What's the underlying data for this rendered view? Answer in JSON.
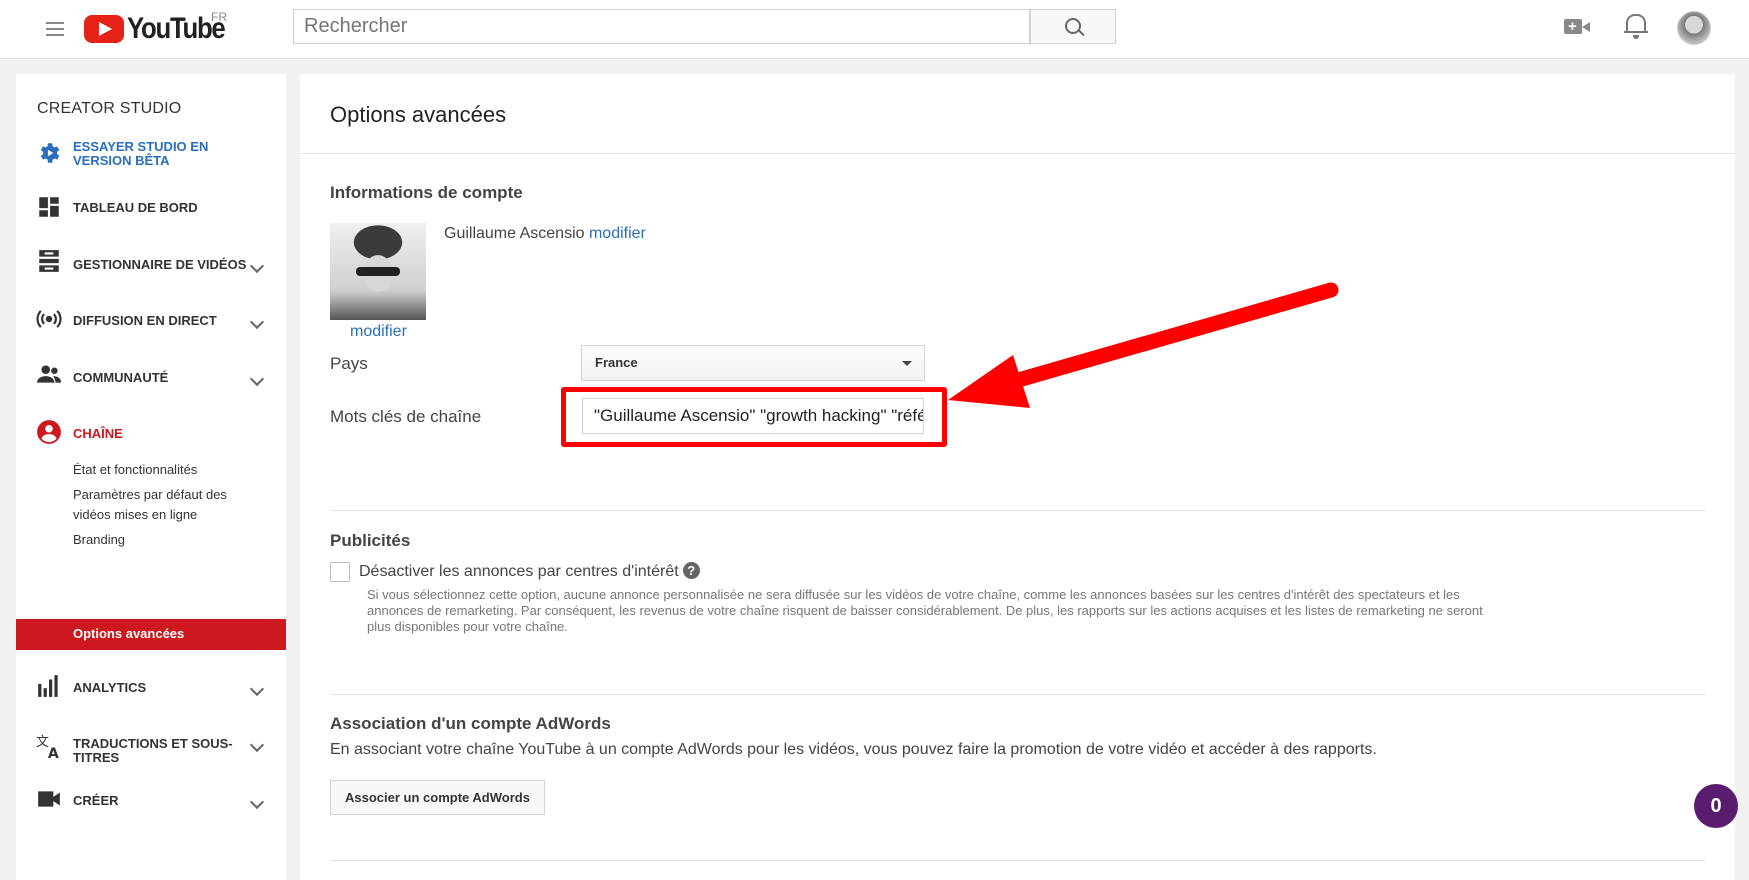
{
  "header": {
    "logo_text": "YouTube",
    "locale_badge": "FR",
    "search_placeholder": "Rechercher",
    "icons": [
      "menu-icon",
      "search-icon",
      "add-video-icon",
      "bell-icon",
      "avatar"
    ]
  },
  "sidebar": {
    "title": "CREATOR STUDIO",
    "items": [
      {
        "icon": "gear-icon",
        "label": "ESSAYER STUDIO EN VERSION BÊTA",
        "color": "#2a6ebd"
      },
      {
        "icon": "dashboard-icon",
        "label": "TABLEAU DE BORD"
      },
      {
        "icon": "video-manager-icon",
        "label": "GESTIONNAIRE DE VIDÉOS",
        "expandable": true
      },
      {
        "icon": "live-icon",
        "label": "DIFFUSION EN DIRECT",
        "expandable": true
      },
      {
        "icon": "community-icon",
        "label": "COMMUNAUTÉ",
        "expandable": true
      },
      {
        "icon": "channel-icon",
        "label": "CHAÎNE",
        "color": "#cc181e"
      },
      {
        "icon": "analytics-icon",
        "label": "ANALYTICS",
        "expandable": true
      },
      {
        "icon": "translate-icon",
        "label": "TRADUCTIONS ET SOUS-TITRES",
        "expandable": true
      },
      {
        "icon": "create-icon",
        "label": "CRÉER",
        "expandable": true
      }
    ],
    "channel_sub": [
      "État et fonctionnalités",
      "Paramètres par défaut des vidéos mises en ligne",
      "Branding",
      "Options avancées"
    ],
    "active_sub": "Options avancées",
    "active_color": "#cc181e"
  },
  "main": {
    "title": "Options avancées",
    "account": {
      "heading": "Informations de compte",
      "name": "Guillaume Ascensio",
      "modify_link": "modifier",
      "photo_modify_link": "modifier",
      "country_label": "Pays",
      "country_value": "France",
      "keywords_label": "Mots clés de chaîne",
      "keywords_value": "\"Guillaume Ascensio\" \"growth hacking\" \"référencement\""
    },
    "ads": {
      "heading": "Publicités",
      "checkbox_label": "Désactiver les annonces par centres d'intérêt",
      "checked": false,
      "help_icon": "?",
      "description": "Si vous sélectionnez cette option, aucune annonce personnalisée ne sera diffusée sur les vidéos de votre chaîne, comme les annonces basées sur les centres d'intérêt des spectateurs et les annonces de remarketing. Par conséquent, les revenus de votre chaîne risquent de baisser considérablement. De plus, les rapports sur les actions acquises et les listes de remarketing ne seront plus disponibles pour votre chaîne."
    },
    "adwords": {
      "heading": "Association d'un compte AdWords",
      "text": "En associant votre chaîne YouTube à un compte AdWords pour les vidéos, vous pouvez faire la promotion de votre vidéo et accéder à des rapports.",
      "button": "Associer un compte AdWords"
    }
  },
  "badge_count": "0",
  "annotation_color": "#ff0000"
}
